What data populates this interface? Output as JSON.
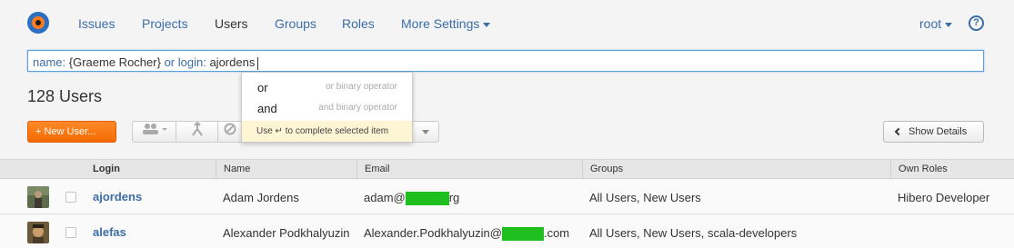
{
  "nav": {
    "items": [
      {
        "label": "Issues"
      },
      {
        "label": "Projects"
      },
      {
        "label": "Users"
      },
      {
        "label": "Groups"
      },
      {
        "label": "Roles"
      },
      {
        "label": "More Settings"
      }
    ],
    "user": "root",
    "help_icon": "question-circle-icon",
    "help_symbol": "?"
  },
  "query": {
    "key1": "name:",
    "val1": "{Graeme Rocher}",
    "op": "or",
    "key2": "login:",
    "val2": "ajordens"
  },
  "title": "128 Users",
  "toolbar": {
    "new_user_label": "+ New User...",
    "show_details_label": "Show Details"
  },
  "suggestions": {
    "items": [
      {
        "op": "or",
        "desc": "or binary operator"
      },
      {
        "op": "and",
        "desc": "and binary operator"
      }
    ],
    "hint": "Use ↵ to complete selected item"
  },
  "table": {
    "headers": [
      "Login",
      "Name",
      "Email",
      "Groups",
      "Own Roles"
    ],
    "rows": [
      {
        "login": "ajordens",
        "name": "Adam Jordens",
        "email_prefix": "adam@",
        "email_suffix": "rg",
        "groups": "All Users, New Users",
        "roles": "Hibero Developer"
      },
      {
        "login": "alefas",
        "name": "Alexander Podkhalyuzin",
        "email_prefix": "Alexander.Podkhalyuzin@",
        "email_suffix": ".com",
        "groups": "All Users, New Users, scala-developers",
        "roles": ""
      }
    ]
  },
  "colors": {
    "accent": "#f26a00",
    "link": "#3b6ea8",
    "redaction": "#1fbf1f"
  }
}
